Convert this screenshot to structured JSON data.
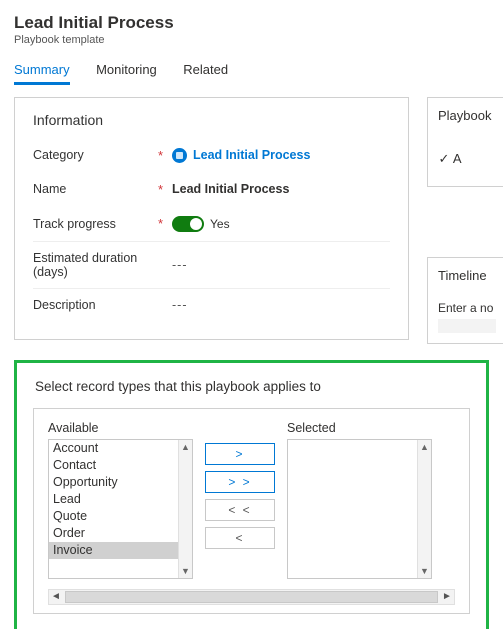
{
  "header": {
    "title": "Lead Initial Process",
    "subtitle": "Playbook template"
  },
  "tabs": {
    "summary": "Summary",
    "monitoring": "Monitoring",
    "related": "Related"
  },
  "info": {
    "section_title": "Information",
    "category_label": "Category",
    "category_value": "Lead Initial Process",
    "name_label": "Name",
    "name_value": "Lead Initial Process",
    "track_label": "Track progress",
    "track_value": "Yes",
    "estdur_label": "Estimated duration (days)",
    "estdur_value": "---",
    "desc_label": "Description",
    "desc_value": "---"
  },
  "side": {
    "playbook_title": "Playbook",
    "activity_prefix": "A",
    "timeline_title": "Timeline",
    "timeline_placeholder": "Enter a no"
  },
  "record_types": {
    "title": "Select record types that this playbook applies to",
    "available_label": "Available",
    "selected_label": "Selected",
    "available": [
      "Account",
      "Contact",
      "Opportunity",
      "Lead",
      "Quote",
      "Order",
      "Invoice"
    ],
    "selected_index": 6,
    "btn_add": ">",
    "btn_add_all": "> >",
    "btn_remove_all": "< <",
    "btn_remove": "<"
  }
}
